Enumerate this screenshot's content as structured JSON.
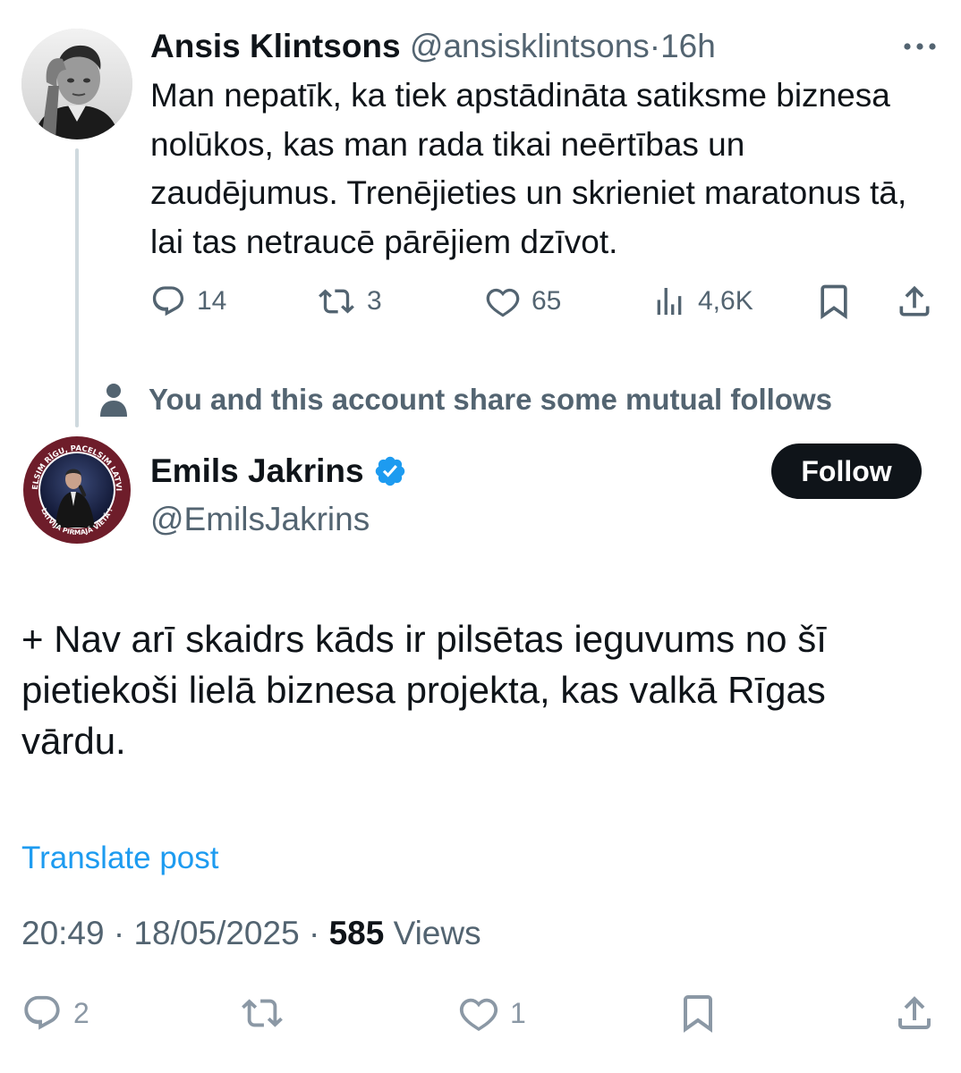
{
  "parent_tweet": {
    "author_name": "Ansis Klintsons",
    "handle": "@ansisklintsons",
    "separator": "·",
    "time": "16h",
    "text": "Man nepatīk, ka tiek apstādināta satiksme biznesa nolūkos, kas  man rada tikai neērtības un zaudējumus. Trenējieties un skrieniet maratonus tā, lai tas netraucē pārējiem dzīvot.",
    "actions": {
      "replies": "14",
      "reposts": "3",
      "likes": "65",
      "views": "4,6K"
    },
    "icons": {
      "more": "more-dots-icon",
      "reply": "reply-bubble-icon",
      "repost": "repost-arrows-icon",
      "like": "heart-icon",
      "views": "analytics-bars-icon",
      "bookmark": "bookmark-icon",
      "share": "share-upload-icon"
    }
  },
  "mutual_follows": {
    "icon": "person-icon",
    "text": "You and this account share some mutual follows"
  },
  "main_tweet": {
    "author_name": "Emils Jakrins",
    "verified": true,
    "handle": "@EmilsJakrins",
    "follow_label": "Follow",
    "text": "+ Nav arī skaidrs kāds ir pilsētas ieguvums no šī pietiekoši lielā biznesa projekta, kas valkā Rīgas vārdu.",
    "translate_label": "Translate post",
    "time": "20:49",
    "separator": "·",
    "date": "18/05/2025",
    "views_count": "585",
    "views_label": "Views",
    "avatar_badge_top": "PACELSIM RĪGU, PACELSIM LATVIJU !",
    "avatar_badge_bottom": "LATVIJA PIRMAJĀ VIETĀ !",
    "actions": {
      "replies": "2",
      "likes": "1"
    }
  },
  "colors": {
    "text_primary": "#0f1419",
    "text_secondary": "#536471",
    "link": "#1d9bf0",
    "verified": "#1d9bf0",
    "follow_bg": "#0f1419",
    "follow_text": "#ffffff",
    "thread_line": "#cfd9de",
    "avatar_ring": "#7a1f2b"
  }
}
